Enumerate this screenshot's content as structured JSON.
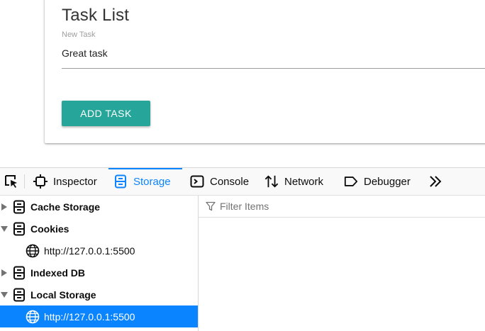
{
  "app": {
    "title": "Task List",
    "new_task_label": "New Task",
    "new_task_value": "Great task",
    "add_button_label": "ADD TASK",
    "accent_color": "#26a69a"
  },
  "devtools": {
    "tabs": [
      {
        "label": "Inspector",
        "icon": "inspector-icon"
      },
      {
        "label": "Storage",
        "icon": "storage-icon",
        "selected": true
      },
      {
        "label": "Console",
        "icon": "console-icon"
      },
      {
        "label": "Network",
        "icon": "network-icon"
      },
      {
        "label": "Debugger",
        "icon": "debugger-icon"
      }
    ],
    "accent_color": "#0a84ff",
    "tree": [
      {
        "label": "Cache Storage",
        "expanded": false
      },
      {
        "label": "Cookies",
        "expanded": true
      },
      {
        "label": "http://127.0.0.1:5500",
        "host": true
      },
      {
        "label": "Indexed DB",
        "expanded": false
      },
      {
        "label": "Local Storage",
        "expanded": true
      },
      {
        "label": "http://127.0.0.1:5500",
        "host": true,
        "selected": true
      }
    ],
    "filter_placeholder": "Filter Items"
  }
}
